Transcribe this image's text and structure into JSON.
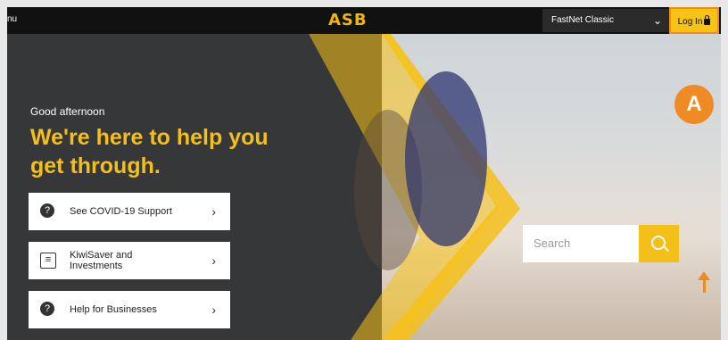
{
  "header": {
    "menu_label": "nu",
    "logo": "ASB",
    "fastnet_label": "FastNet Classic",
    "login_label": "Log In"
  },
  "hero": {
    "greeting": "Good afternoon",
    "headline": "We're here to help you get through."
  },
  "cards": [
    {
      "label": "See COVID-19 Support",
      "icon": "question-circle-icon"
    },
    {
      "label": "KiwiSaver and Investments",
      "icon": "document-icon"
    },
    {
      "label": "Help for Businesses",
      "icon": "question-circle-icon"
    }
  ],
  "search": {
    "placeholder": "Search"
  },
  "annotation": {
    "label": "A"
  },
  "colors": {
    "accent": "#f5bf1a",
    "annotation": "#f08a24",
    "header": "#111111"
  }
}
